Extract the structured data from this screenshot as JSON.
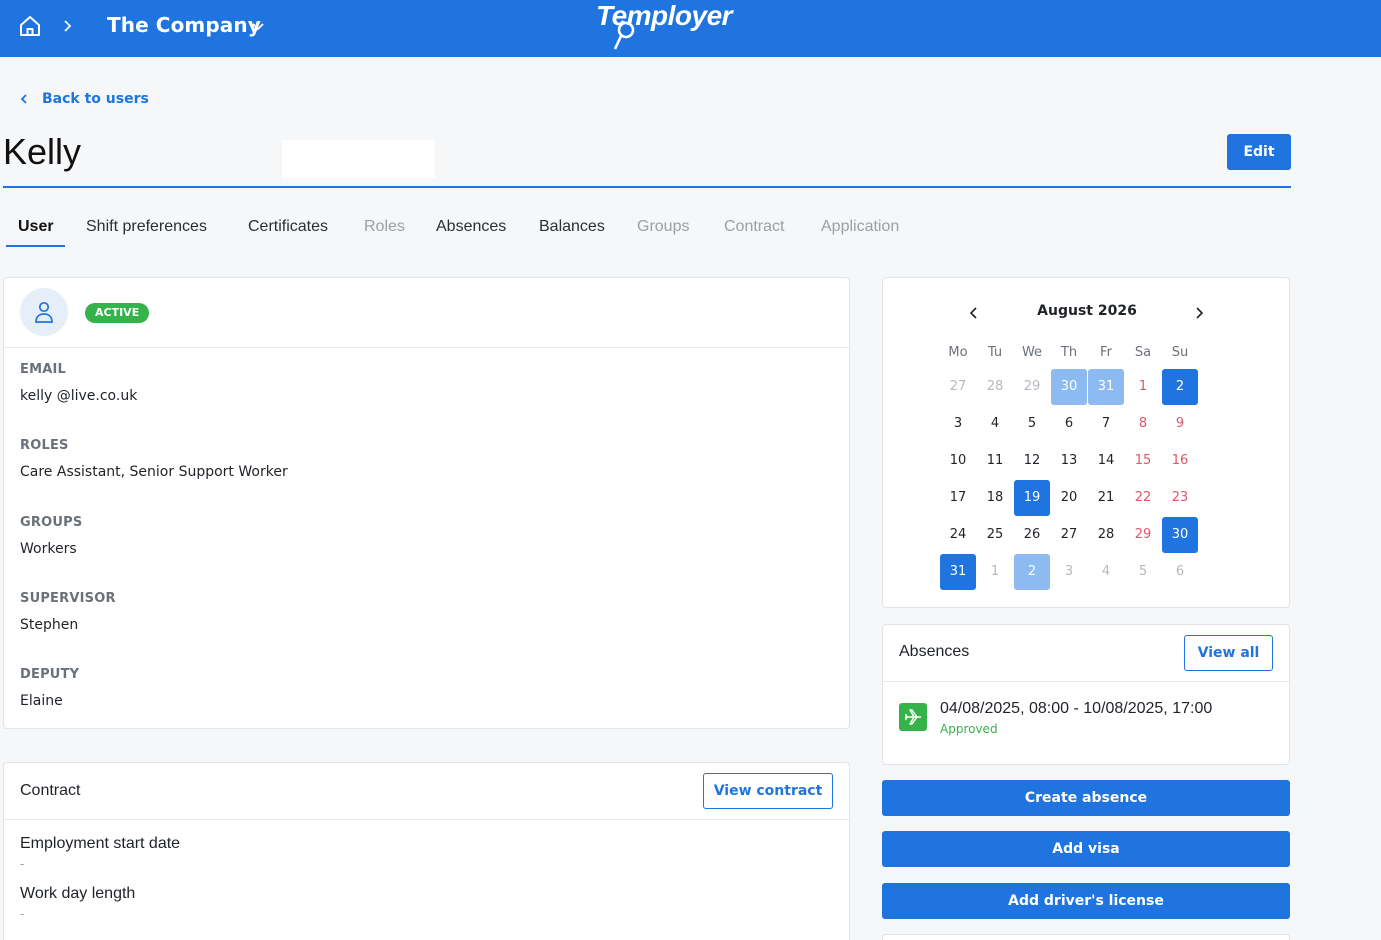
{
  "topbar": {
    "company": "The Company",
    "logo_text": "Temployer",
    "colors": {
      "brand": "#1f74e0"
    }
  },
  "nav": {
    "back_label": "Back to users"
  },
  "header": {
    "title": "Kelly",
    "edit_label": "Edit"
  },
  "tabs": [
    {
      "label": "User",
      "state": "active"
    },
    {
      "label": "Shift preferences",
      "state": "enabled"
    },
    {
      "label": "Certificates",
      "state": "enabled"
    },
    {
      "label": "Roles",
      "state": "disabled"
    },
    {
      "label": "Absences",
      "state": "enabled"
    },
    {
      "label": "Balances",
      "state": "enabled"
    },
    {
      "label": "Groups",
      "state": "disabled"
    },
    {
      "label": "Contract",
      "state": "disabled"
    },
    {
      "label": "Application",
      "state": "disabled"
    }
  ],
  "user": {
    "status": "ACTIVE",
    "fields": [
      {
        "label": "EMAIL",
        "value": "kelly @live.co.uk"
      },
      {
        "label": "ROLES",
        "value": "Care Assistant, Senior Support Worker"
      },
      {
        "label": "GROUPS",
        "value": "Workers"
      },
      {
        "label": "SUPERVISOR",
        "value": "Stephen"
      },
      {
        "label": "DEPUTY",
        "value": "Elaine"
      }
    ]
  },
  "contract": {
    "title": "Contract",
    "view_label": "View contract",
    "fields": [
      {
        "label": "Employment start date",
        "value": "-"
      },
      {
        "label": "Work day length",
        "value": "-"
      }
    ]
  },
  "calendar": {
    "month": "August 2026",
    "weekdays": [
      "Mo",
      "Tu",
      "We",
      "Th",
      "Fr",
      "Sa",
      "Su"
    ],
    "weeks": [
      [
        {
          "d": "27",
          "s": "muted"
        },
        {
          "d": "28",
          "s": "muted"
        },
        {
          "d": "29",
          "s": "muted"
        },
        {
          "d": "30",
          "s": "light"
        },
        {
          "d": "31",
          "s": "light"
        },
        {
          "d": "1",
          "s": "weekend"
        },
        {
          "d": "2",
          "s": "sel"
        }
      ],
      [
        {
          "d": "3",
          "s": ""
        },
        {
          "d": "4",
          "s": ""
        },
        {
          "d": "5",
          "s": ""
        },
        {
          "d": "6",
          "s": ""
        },
        {
          "d": "7",
          "s": ""
        },
        {
          "d": "8",
          "s": "weekend"
        },
        {
          "d": "9",
          "s": "weekend"
        }
      ],
      [
        {
          "d": "10",
          "s": ""
        },
        {
          "d": "11",
          "s": ""
        },
        {
          "d": "12",
          "s": ""
        },
        {
          "d": "13",
          "s": ""
        },
        {
          "d": "14",
          "s": ""
        },
        {
          "d": "15",
          "s": "weekend"
        },
        {
          "d": "16",
          "s": "weekend"
        }
      ],
      [
        {
          "d": "17",
          "s": ""
        },
        {
          "d": "18",
          "s": ""
        },
        {
          "d": "19",
          "s": "sel"
        },
        {
          "d": "20",
          "s": ""
        },
        {
          "d": "21",
          "s": ""
        },
        {
          "d": "22",
          "s": "weekend"
        },
        {
          "d": "23",
          "s": "weekend"
        }
      ],
      [
        {
          "d": "24",
          "s": ""
        },
        {
          "d": "25",
          "s": ""
        },
        {
          "d": "26",
          "s": ""
        },
        {
          "d": "27",
          "s": ""
        },
        {
          "d": "28",
          "s": ""
        },
        {
          "d": "29",
          "s": "weekend"
        },
        {
          "d": "30",
          "s": "sel"
        }
      ],
      [
        {
          "d": "31",
          "s": "sel"
        },
        {
          "d": "1",
          "s": "muted"
        },
        {
          "d": "2",
          "s": "light"
        },
        {
          "d": "3",
          "s": "muted"
        },
        {
          "d": "4",
          "s": "muted"
        },
        {
          "d": "5",
          "s": "muted"
        },
        {
          "d": "6",
          "s": "muted"
        }
      ]
    ]
  },
  "absences": {
    "title": "Absences",
    "view_all_label": "View all",
    "items": [
      {
        "range": "04/08/2025, 08:00 - 10/08/2025, 17:00",
        "status": "Approved",
        "icon": "plane-icon"
      }
    ]
  },
  "actions": [
    {
      "label": "Create absence",
      "name": "create-absence-button"
    },
    {
      "label": "Add visa",
      "name": "add-visa-button"
    },
    {
      "label": "Add driver's license",
      "name": "add-drivers-license-button"
    }
  ]
}
